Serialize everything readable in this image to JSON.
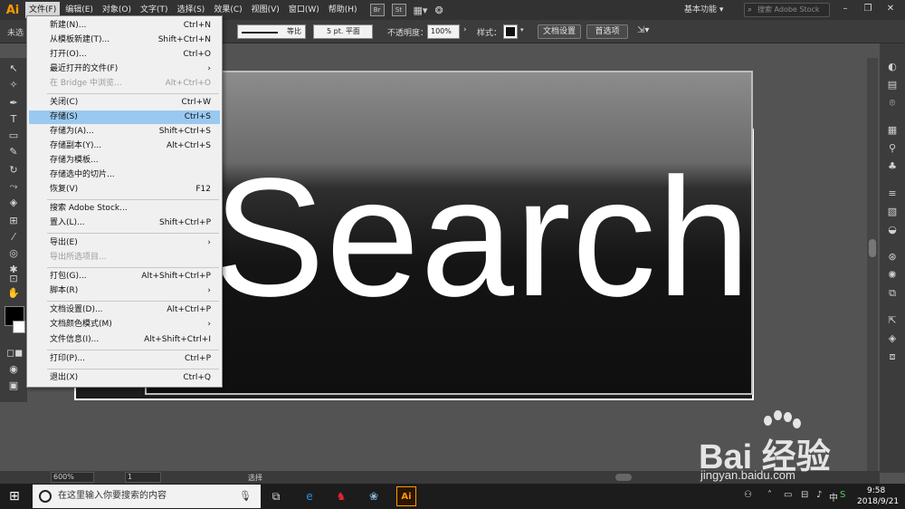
{
  "app": {
    "logo": "Ai",
    "workspace": "基本功能",
    "stock_search_placeholder": "搜索 Adobe Stock"
  },
  "menubar": {
    "items": [
      "文件(F)",
      "编辑(E)",
      "对象(O)",
      "文字(T)",
      "选择(S)",
      "效果(C)",
      "视图(V)",
      "窗口(W)",
      "帮助(H)"
    ],
    "bridge_icon": "Br",
    "stock_icon": "St"
  },
  "controlbar": {
    "no_selection": "未选",
    "stroke_profile": "等比",
    "brush_size": "5 pt. 平面",
    "opacity_label": "不透明度：",
    "opacity_value": "100%",
    "style_label": "样式：",
    "doc_setup": "文档设置",
    "preferences": "首选项"
  },
  "file_menu": {
    "items": [
      {
        "label": "新建(N)...",
        "shortcut": "Ctrl+N",
        "disabled": false
      },
      {
        "label": "从模板新建(T)...",
        "shortcut": "Shift+Ctrl+N",
        "disabled": false
      },
      {
        "label": "打开(O)...",
        "shortcut": "Ctrl+O",
        "disabled": false
      },
      {
        "label": "最近打开的文件(F)",
        "shortcut": "›",
        "disabled": false
      },
      {
        "label": "在 Bridge 中浏览...",
        "shortcut": "Alt+Ctrl+O",
        "disabled": true
      },
      {
        "label": "关闭(C)",
        "shortcut": "Ctrl+W",
        "disabled": false
      },
      {
        "label": "存储(S)",
        "shortcut": "Ctrl+S",
        "disabled": false,
        "selected": true
      },
      {
        "label": "存储为(A)...",
        "shortcut": "Shift+Ctrl+S",
        "disabled": false
      },
      {
        "label": "存储副本(Y)...",
        "shortcut": "Alt+Ctrl+S",
        "disabled": false
      },
      {
        "label": "存储为模板...",
        "shortcut": "",
        "disabled": false
      },
      {
        "label": "存储选中的切片...",
        "shortcut": "",
        "disabled": false
      },
      {
        "label": "恢复(V)",
        "shortcut": "F12",
        "disabled": false
      },
      {
        "label": "搜索 Adobe Stock...",
        "shortcut": "",
        "disabled": false
      },
      {
        "label": "置入(L)...",
        "shortcut": "Shift+Ctrl+P",
        "disabled": false
      },
      {
        "label": "导出(E)",
        "shortcut": "›",
        "disabled": false
      },
      {
        "label": "导出所选项目...",
        "shortcut": "",
        "disabled": true
      },
      {
        "label": "打包(G)...",
        "shortcut": "Alt+Shift+Ctrl+P",
        "disabled": false
      },
      {
        "label": "脚本(R)",
        "shortcut": "›",
        "disabled": false
      },
      {
        "label": "文档设置(D)...",
        "shortcut": "Alt+Ctrl+P",
        "disabled": false
      },
      {
        "label": "文档颜色模式(M)",
        "shortcut": "›",
        "disabled": false
      },
      {
        "label": "文件信息(I)...",
        "shortcut": "Alt+Shift+Ctrl+I",
        "disabled": false
      },
      {
        "label": "打印(P)...",
        "shortcut": "Ctrl+P",
        "disabled": false
      },
      {
        "label": "退出(X)",
        "shortcut": "Ctrl+Q",
        "disabled": false
      }
    ]
  },
  "canvas": {
    "button_text": "Search"
  },
  "statusbar": {
    "zoom": "600%",
    "artboard": "1",
    "status": "选择"
  },
  "taskbar": {
    "search_placeholder": "在这里输入你要搜索的内容",
    "time": "9:58",
    "date": "2018/9/21",
    "ai_label": "Ai"
  },
  "watermark": {
    "logo": "Bai 经验",
    "url": "jingyan.baidu.com"
  }
}
